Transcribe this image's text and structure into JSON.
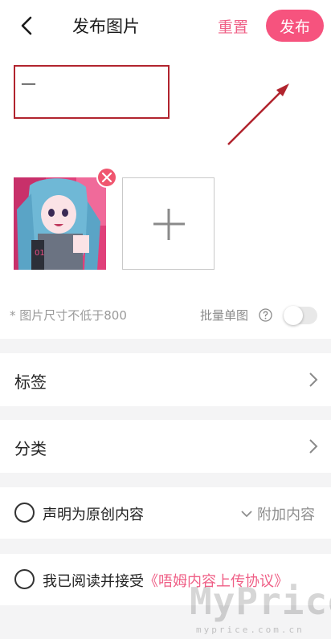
{
  "header": {
    "title": "发布图片",
    "reset_label": "重置",
    "publish_label": "发布"
  },
  "editor": {
    "text_value": "—",
    "images": [
      {
        "description": "anime character thumbnail"
      }
    ],
    "add_icon": "plus-icon",
    "remove_icon": "close-icon",
    "hint": "* 图片尺寸不低于800",
    "batch_label": "批量单图",
    "batch_toggle": false
  },
  "rows": {
    "tags_label": "标签",
    "category_label": "分类"
  },
  "declare": {
    "label": "声明为原创内容",
    "extra_label": "附加内容"
  },
  "agreement": {
    "prefix": "我已阅读并接受",
    "link": "《唔姆内容上传协议》"
  },
  "watermark": {
    "main": "MyPrice",
    "sub": "myprice.com.cn"
  },
  "colors": {
    "accent": "#f6537e",
    "annotation": "#b1242e"
  }
}
